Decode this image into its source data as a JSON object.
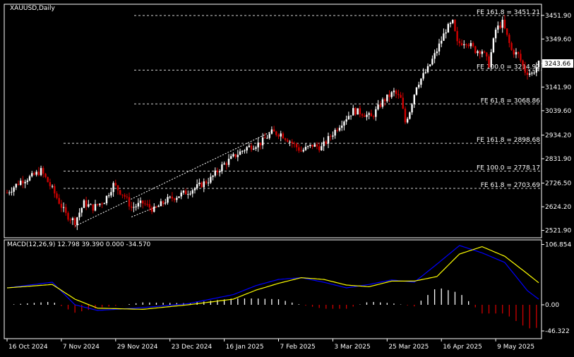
{
  "symbol_title": "XAUUSD,Daily",
  "macd_title": "MACD(12,26,9) 12.798 39.390 0.000 -34.570",
  "colors": {
    "bg": "#000000",
    "frame": "#ffffff",
    "bull": "#ffffff",
    "bear": "#d00000",
    "macd_line": "#0000ff",
    "signal_line": "#ffff00",
    "hist_pos": "#ffffff",
    "hist_neg": "#d00000",
    "fib_line": "#cfcfcf",
    "trend": "#ffffff"
  },
  "price_axis": {
    "ticks": [
      "3451.90",
      "3349.60",
      "3243.66",
      "3141.90",
      "3039.60",
      "2934.20",
      "2831.90",
      "2726.50",
      "2624.20",
      "2521.90"
    ],
    "min": 2490,
    "max": 3500
  },
  "current_price": "3243.66",
  "fib_levels": [
    {
      "label": "FE 161.8 = 3451.21",
      "price": 3451.21
    },
    {
      "label": "FE 100.0 = 3214.92",
      "price": 3214.92
    },
    {
      "label": "FE 61.8 = 3068.86",
      "price": 3068.86
    },
    {
      "label": "FE 161.8 = 2898.68",
      "price": 2898.68
    },
    {
      "label": "FE 100.0 = 2778.17",
      "price": 2778.17
    },
    {
      "label": "FE 61.8 = 2703.69",
      "price": 2703.69
    }
  ],
  "macd_axis": {
    "ticks": [
      "106.854",
      "0.00",
      "-46.322"
    ]
  },
  "time_axis": {
    "labels": [
      "16 Oct 2024",
      "7 Nov 2024",
      "29 Nov 2024",
      "23 Dec 2024",
      "16 Jan 2025",
      "7 Feb 2025",
      "3 Mar 2025",
      "25 Mar 2025",
      "16 Apr 2025",
      "9 May 2025"
    ]
  },
  "chart_data": {
    "type": "candlestick",
    "close_path": [
      [
        0,
        2685
      ],
      [
        6,
        2735
      ],
      [
        11,
        2755
      ],
      [
        15,
        2780
      ],
      [
        20,
        2700
      ],
      [
        26,
        2590
      ],
      [
        30,
        2560
      ],
      [
        34,
        2640
      ],
      [
        38,
        2620
      ],
      [
        43,
        2650
      ],
      [
        47,
        2720
      ],
      [
        52,
        2670
      ],
      [
        55,
        2620
      ],
      [
        60,
        2640
      ],
      [
        65,
        2610
      ],
      [
        70,
        2650
      ],
      [
        75,
        2670
      ],
      [
        80,
        2690
      ],
      [
        85,
        2715
      ],
      [
        90,
        2745
      ],
      [
        95,
        2800
      ],
      [
        100,
        2840
      ],
      [
        106,
        2880
      ],
      [
        112,
        2900
      ],
      [
        117,
        2945
      ],
      [
        121,
        2940
      ],
      [
        126,
        2900
      ],
      [
        130,
        2865
      ],
      [
        135,
        2890
      ],
      [
        139,
        2880
      ],
      [
        143,
        2930
      ],
      [
        148,
        2990
      ],
      [
        153,
        3040
      ],
      [
        157,
        3030
      ],
      [
        161,
        3010
      ],
      [
        166,
        3080
      ],
      [
        171,
        3120
      ],
      [
        174,
        3090
      ],
      [
        176,
        2990
      ],
      [
        178,
        3040
      ],
      [
        181,
        3150
      ],
      [
        186,
        3220
      ],
      [
        190,
        3300
      ],
      [
        194,
        3390
      ],
      [
        197,
        3420
      ],
      [
        199,
        3330
      ],
      [
        203,
        3340
      ],
      [
        207,
        3300
      ],
      [
        210,
        3300
      ],
      [
        213,
        3240
      ],
      [
        216,
        3390
      ],
      [
        219,
        3420
      ],
      [
        223,
        3300
      ],
      [
        226,
        3280
      ],
      [
        229,
        3210
      ],
      [
        232,
        3200
      ],
      [
        235,
        3243
      ]
    ],
    "macd_path": [
      [
        0,
        30
      ],
      [
        20,
        40
      ],
      [
        30,
        0
      ],
      [
        40,
        -10
      ],
      [
        60,
        -5
      ],
      [
        80,
        2
      ],
      [
        100,
        18
      ],
      [
        110,
        34
      ],
      [
        120,
        45
      ],
      [
        130,
        48
      ],
      [
        140,
        40
      ],
      [
        150,
        30
      ],
      [
        160,
        36
      ],
      [
        170,
        44
      ],
      [
        180,
        40
      ],
      [
        190,
        72
      ],
      [
        200,
        105
      ],
      [
        210,
        92
      ],
      [
        220,
        75
      ],
      [
        230,
        25
      ],
      [
        235,
        10
      ]
    ],
    "signal_path": [
      [
        0,
        30
      ],
      [
        20,
        36
      ],
      [
        30,
        10
      ],
      [
        40,
        -6
      ],
      [
        60,
        -8
      ],
      [
        80,
        0
      ],
      [
        100,
        10
      ],
      [
        110,
        26
      ],
      [
        120,
        38
      ],
      [
        130,
        48
      ],
      [
        140,
        45
      ],
      [
        150,
        35
      ],
      [
        160,
        32
      ],
      [
        170,
        42
      ],
      [
        180,
        42
      ],
      [
        190,
        50
      ],
      [
        200,
        90
      ],
      [
        210,
        103
      ],
      [
        220,
        86
      ],
      [
        230,
        55
      ],
      [
        235,
        39
      ]
    ]
  }
}
